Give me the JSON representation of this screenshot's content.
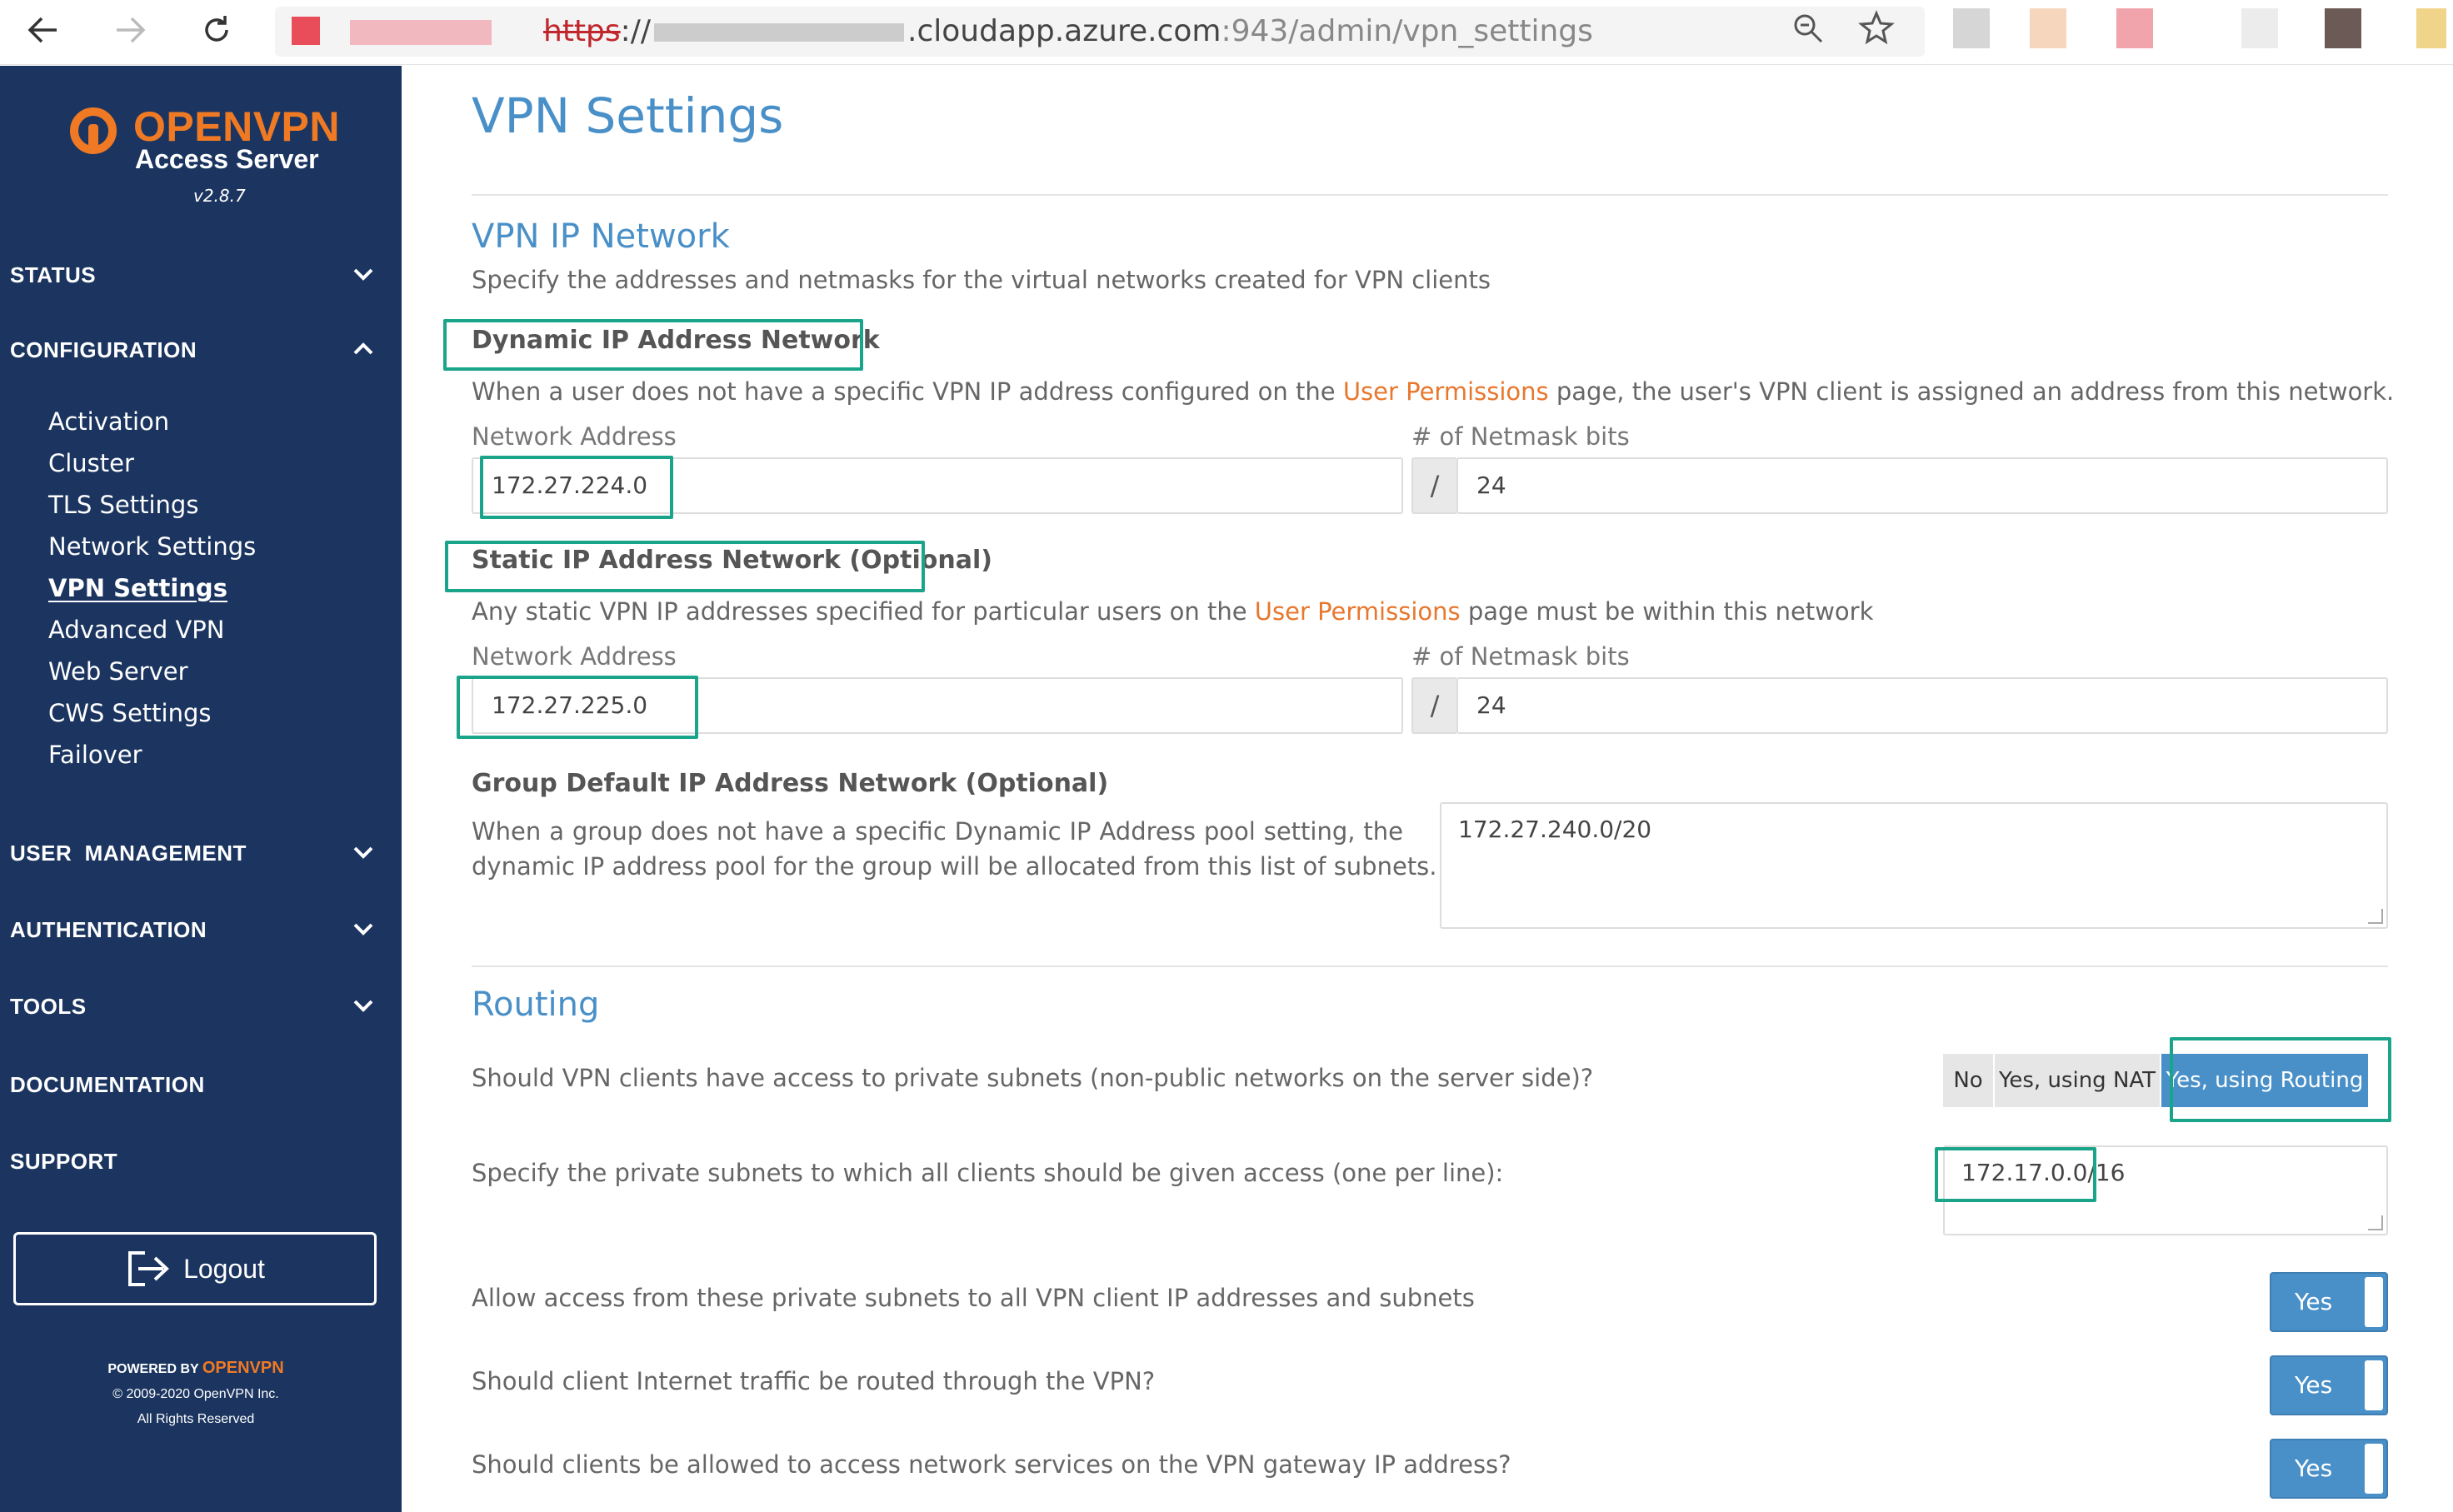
{
  "browser": {
    "url_scheme": "https",
    "url_sep": "://",
    "url_host": ".cloudapp.azure.com",
    "url_port": ":943",
    "url_path": "/admin/vpn_settings"
  },
  "sidebar": {
    "brand_open": "OPEN",
    "brand_vpn": "VPN",
    "subtitle": "Access Server",
    "version": "v2.8.7",
    "sections": {
      "status": "STATUS",
      "configuration": "CONFIGURATION",
      "user_management": "USER  MANAGEMENT",
      "authentication": "AUTHENTICATION",
      "tools": "TOOLS",
      "documentation": "DOCUMENTATION",
      "support": "SUPPORT"
    },
    "config_items": [
      "Activation",
      "Cluster",
      "TLS Settings",
      "Network Settings",
      "VPN Settings",
      "Advanced VPN",
      "Web Server",
      "CWS Settings",
      "Failover"
    ],
    "logout": "Logout",
    "footer": {
      "powered_by": "POWERED BY",
      "powered_brand": "OPENVPN",
      "copyright": "© 2009-2020 OpenVPN Inc.",
      "rights": "All Rights Reserved"
    }
  },
  "main": {
    "title": "VPN Settings",
    "vpn_ip_network": {
      "title": "VPN IP Network",
      "description": "Specify the addresses and netmasks for the virtual networks created for VPN clients",
      "dynamic": {
        "title": "Dynamic IP Address Network",
        "desc_pre": "When a user does not have a specific VPN IP address configured on the ",
        "desc_link": "User Permissions",
        "desc_post": " page, the user's VPN client is assigned an address from this network.",
        "network_label": "Network Address",
        "network_value": "172.27.224.0",
        "netmask_label": "# of Netmask bits",
        "netmask_prefix": "/",
        "netmask_value": "24"
      },
      "static": {
        "title": "Static IP Address Network (Optional)",
        "desc_pre": "Any static VPN IP addresses specified for particular users on the ",
        "desc_link": "User Permissions",
        "desc_post": " page must be within this network",
        "network_label": "Network Address",
        "network_value": "172.27.225.0",
        "netmask_label": "# of Netmask bits",
        "netmask_prefix": "/",
        "netmask_value": "24"
      },
      "group_default": {
        "title": "Group Default IP Address Network (Optional)",
        "desc_line1": "When a group does not have a specific Dynamic IP Address pool setting, the",
        "desc_line2": "dynamic IP address pool for the group will be allocated from this list of subnets.",
        "value": "172.27.240.0/20"
      }
    },
    "routing": {
      "title": "Routing",
      "q_private_access": "Should VPN clients have access to private subnets (non-public networks on the server side)?",
      "options": [
        "No",
        "Yes, using NAT",
        "Yes, using Routing"
      ],
      "selected": "Yes, using Routing",
      "q_subnets": "Specify the private subnets to which all clients should be given access (one per line):",
      "subnets_value": "172.17.0.0/16",
      "q_allow_access": "Allow access from these private subnets to all VPN client IP addresses and subnets",
      "allow_access": "Yes",
      "q_internet_traffic": "Should client Internet traffic be routed through the VPN?",
      "internet_traffic": "Yes",
      "q_gateway_services": "Should clients be allowed to access network services on the VPN gateway IP address?",
      "gateway_services": "Yes"
    }
  },
  "colors": {
    "sidebar_bg": "#1b3560",
    "accent_blue": "#4a90c8",
    "brand_orange": "#f07a24",
    "link_orange": "#e8772e",
    "highlight_teal": "#1aa58a"
  }
}
